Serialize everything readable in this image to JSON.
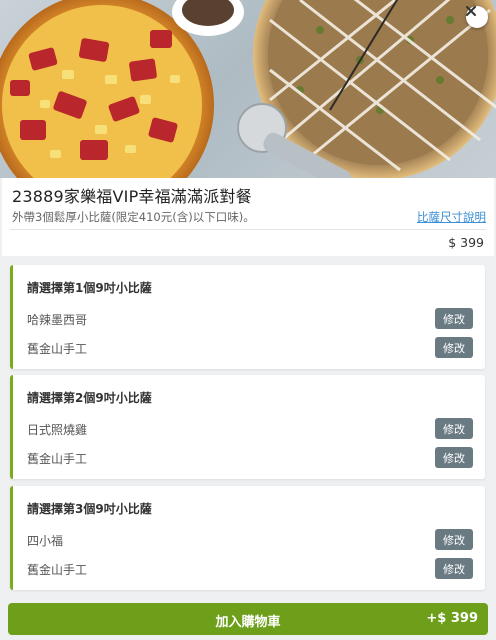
{
  "header": {
    "close_icon": "close-icon"
  },
  "product": {
    "title": "23889家樂福VIP幸福滿滿派對餐",
    "description": "外帶3個鬆厚小比薩(限定410元(含)以下口味)。",
    "size_link": "比薩尺寸說明",
    "price": "$ 399"
  },
  "groups": [
    {
      "title": "請選擇第1個9吋小比薩",
      "choices": [
        {
          "name": "哈辣墨西哥",
          "button": "修改"
        },
        {
          "name": "舊金山手工",
          "button": "修改"
        }
      ]
    },
    {
      "title": "請選擇第2個9吋小比薩",
      "choices": [
        {
          "name": "日式照燒雞",
          "button": "修改"
        },
        {
          "name": "舊金山手工",
          "button": "修改"
        }
      ]
    },
    {
      "title": "請選擇第3個9吋小比薩",
      "choices": [
        {
          "name": "四小福",
          "button": "修改"
        },
        {
          "name": "舊金山手工",
          "button": "修改"
        }
      ]
    }
  ],
  "cart": {
    "label": "加入購物車",
    "price": "+$ 399"
  },
  "colors": {
    "accent_green": "#6d9f1a",
    "group_border": "#7aab1d",
    "edit_button": "#6a7a83",
    "link": "#3a8fd6"
  }
}
